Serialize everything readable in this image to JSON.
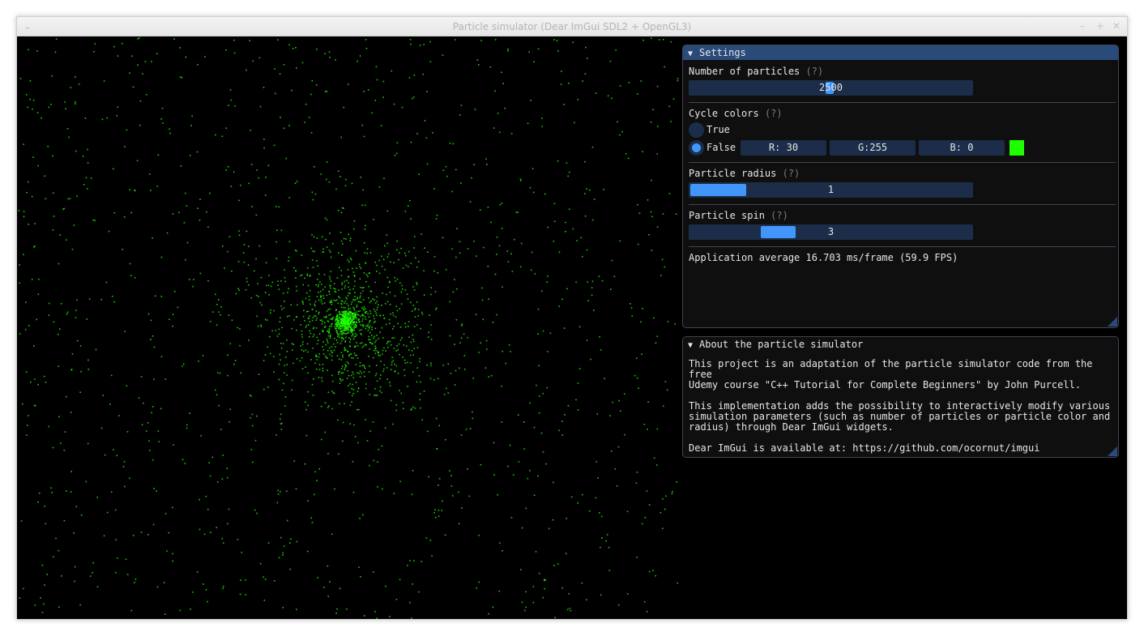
{
  "window": {
    "title": "Particle simulator (Dear ImGui SDL2 + OpenGL3)",
    "menu_glyph": "⌄",
    "minimize_glyph": "–",
    "maximize_glyph": "+",
    "close_glyph": "✕"
  },
  "simulation": {
    "particle_count": 2500,
    "particle_color": "#1eff00",
    "particle_radius": 1,
    "particle_spin": 3
  },
  "settings": {
    "header": "Settings",
    "arrow": "▼",
    "help": "(?)",
    "num_particles": {
      "label": "Number of particles",
      "value": "2500",
      "fraction": 0.5
    },
    "cycle_colors": {
      "label": "Cycle colors",
      "option_true": "True",
      "option_false": "False",
      "selected": "False",
      "r": "R: 30",
      "g": "G:255",
      "b": "B:  0",
      "swatch": "#1eff00"
    },
    "radius": {
      "label": "Particle radius",
      "value": "1",
      "fraction": 0.0
    },
    "spin": {
      "label": "Particle spin",
      "value": "3",
      "fraction": 0.3
    },
    "fps_text": "Application average 16.703 ms/frame (59.9 FPS)"
  },
  "about": {
    "header": "About the particle simulator",
    "arrow": "▼",
    "text": "This project is an adaptation of the particle simulator code from the free\nUdemy course \"C++ Tutorial for Complete Beginners\" by John Purcell.\n\nThis implementation adds the possibility to interactively modify various\nsimulation parameters (such as number of particles or particle color and\nradius) through Dear ImGui widgets.\n\nDear ImGui is available at: https://github.com/ocornut/imgui"
  },
  "colors": {
    "accent": "#4296fa",
    "frame": "#1b2d49",
    "header_active": "#2a4a7a",
    "panel_bg": "#0f0f0f",
    "border": "#434352"
  }
}
